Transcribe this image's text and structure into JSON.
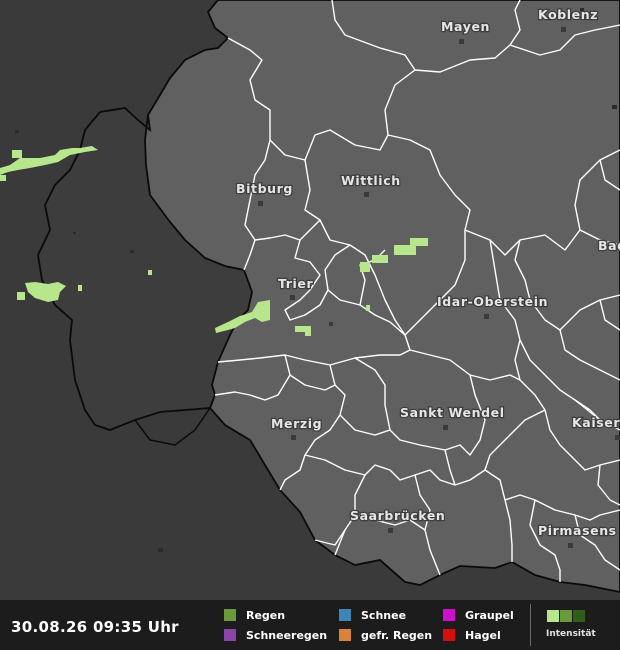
{
  "map": {
    "cities": [
      {
        "id": "mayen",
        "label": "Mayen"
      },
      {
        "id": "koblenz",
        "label": "Koblenz"
      },
      {
        "id": "bitburg",
        "label": "Bitburg"
      },
      {
        "id": "wittlich",
        "label": "Wittlich"
      },
      {
        "id": "trier",
        "label": "Trier"
      },
      {
        "id": "idar",
        "label": "Idar-Oberstein"
      },
      {
        "id": "bad",
        "label": "Bad"
      },
      {
        "id": "merzig",
        "label": "Merzig"
      },
      {
        "id": "wendel",
        "label": "Sankt Wendel"
      },
      {
        "id": "kaisers",
        "label": "Kaisers"
      },
      {
        "id": "saarbruecken",
        "label": "Saarbrücken"
      },
      {
        "id": "pirmasens",
        "label": "Pirmasens"
      }
    ]
  },
  "legend": {
    "timestamp": "30.08.26 09:35 Uhr",
    "items": [
      {
        "label": "Regen",
        "color": "#6a9a3c"
      },
      {
        "label": "Schneeregen",
        "color": "#8b44a8"
      },
      {
        "label": "Schnee",
        "color": "#3f86b8"
      },
      {
        "label": "gefr. Regen",
        "color": "#d9823a"
      },
      {
        "label": "Graupel",
        "color": "#cc10cc"
      },
      {
        "label": "Hagel",
        "color": "#d40f0f"
      }
    ],
    "intensity_label": "Intensität",
    "intensity_colors": [
      "#b8e68c",
      "#6a9a3c",
      "#2f5e1a"
    ]
  },
  "colors": {
    "background": "#3a3a3a",
    "region": "#606060",
    "border": "#ffffff",
    "country_border": "#0a0a0a",
    "rain": "#b8e68c"
  }
}
